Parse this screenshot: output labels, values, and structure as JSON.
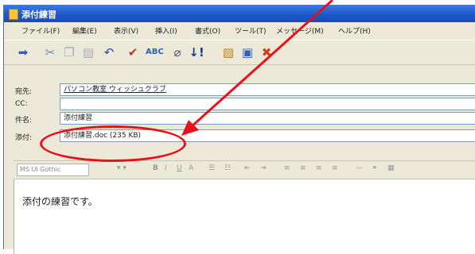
{
  "window": {
    "title": "添付練習"
  },
  "menu": [
    "ファイル(F)",
    "編集(E)",
    "表示(V)",
    "挿入(I)",
    "書式(O)",
    "ツール(T)",
    "メッセージ(M)",
    "ヘルプ(H)"
  ],
  "toolbar": {
    "icons": [
      "send-icon",
      "cut-icon",
      "copy-icon",
      "paste-icon",
      "undo-icon",
      "check-names-icon",
      "spelling-icon",
      "attach-icon",
      "priority-icon",
      "sign-icon",
      "encrypt-icon",
      "offline-icon"
    ]
  },
  "header": {
    "to_label": "宛先:",
    "to_value": "パソコン教室 ウィッシュクラブ",
    "cc_label": "CC:",
    "cc_value": "",
    "subject_label": "件名:",
    "subject_value": "添付練習",
    "attach_label": "添付:",
    "attach_value": "添付練習.doc (235 KB)"
  },
  "format_bar": {
    "font": "MS UI Gothic"
  },
  "body": {
    "text": "添付の練習です。"
  },
  "annotation": {
    "color": "#e8101a"
  }
}
